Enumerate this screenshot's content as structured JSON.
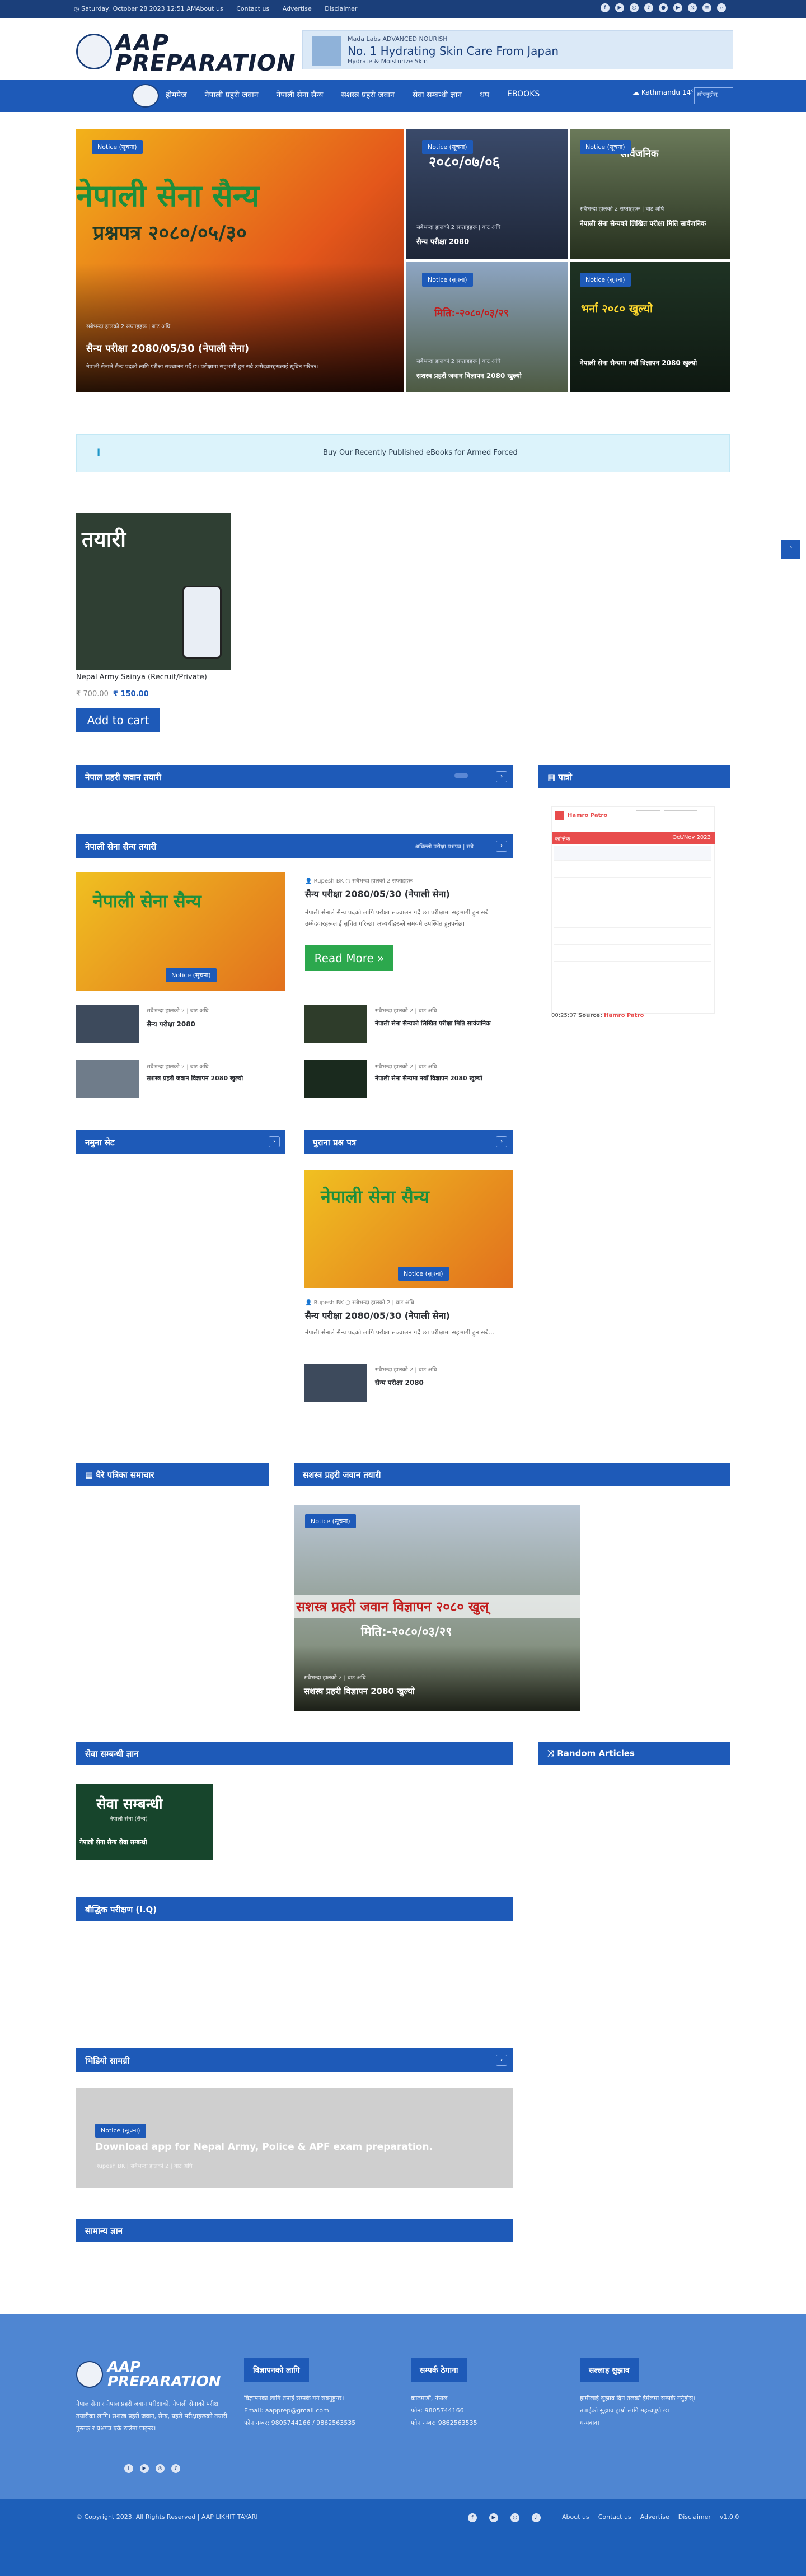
{
  "topbar": {
    "date": "Saturday, October 28 2023 12:51 AM",
    "links": [
      "About us",
      "Contact us",
      "Advertise",
      "Disclaimer"
    ]
  },
  "header": {
    "logo_line1": "AAP",
    "logo_line2": "PREPARATION",
    "ad_small1": "Mada Labs ADVANCED NOURISH",
    "ad_big": "No. 1 Hydrating Skin Care From Japan",
    "ad_small2": "Hydrate & Moisturize Skin"
  },
  "nav": {
    "items": [
      "होमपेज",
      "नेपाली प्रहरी जवान",
      "नेपाली सेना सैन्य",
      "सशस्त्र प्रहरी जवान",
      "सेवा सम्बन्धी ज्ञान",
      "थप",
      "EBOOKS"
    ],
    "weather": "Kathmandu 14",
    "search": "खोज्नुहोस्"
  },
  "hero": {
    "main": {
      "badge": "Notice (सूचना)",
      "title": "सैन्य परीक्षा 2080/05/30 (नेपाली सेना)",
      "meta": "सबैभन्दा हालको 2 सप्ताहहरू | बाट अघि",
      "desc": "नेपाली सेनाले सैन्य पदको लागि परीक्षा सञ्चालन गर्दै छ। परीक्षामा सहभागी हुन सबै उम्मेदवारहरूलाई सूचित गरिन्छ।",
      "banner": "नेपाली सेना सैन्य",
      "banner2": "प्रश्नपत्र २०८०/०५/३०"
    },
    "c1": {
      "badge": "Notice (सूचना)",
      "title": "सैन्य परीक्षा 2080",
      "meta": "सबैभन्दा हालको 2 सप्ताहहरू | बाट अघि",
      "banner": "२०८०/०७/०६"
    },
    "c2": {
      "badge": "Notice (सूचना)",
      "title": "नेपाली सेना सैन्यको लिखित परीक्षा मिति सार्वजनिक",
      "meta": "सबैभन्दा हालको 2 सप्ताहहरू | बाट अघि",
      "banner": "सार्वजनिक"
    },
    "c3": {
      "badge": "Notice (सूचना)",
      "title": "सशस्त्र प्रहरी जवान विज्ञापन 2080 खुल्यो",
      "meta": "सबैभन्दा हालको 2 सप्ताहहरू | बाट अघि",
      "banner": "मिति:-२०८०/०३/२९"
    },
    "c4": {
      "badge": "Notice (सूचना)",
      "title": "नेपाली सेना सैन्यमा नयाँ विज्ञापन 2080 खुल्यो",
      "meta": "सबैभन्दा हालको 2 सप्ताहहरू | बाट अघि",
      "banner": "भर्ना २०८० खुल्यो"
    }
  },
  "notice": {
    "text": "Buy Our Recently Published eBooks for Armed Forced"
  },
  "product": {
    "banner": "तयारी",
    "name": "Nepal Army Sainya (Recruit/Private)",
    "old_price": "₹ 700.00",
    "new_price": "₹ 150.00",
    "cart": "Add to cart"
  },
  "sections": {
    "np": {
      "title": "नेपाल प्रहरी जवान तयारी",
      "extra": ""
    },
    "na": {
      "title": "नेपाली सेना सैन्य तयारी",
      "extra": "अघिल्लो परीक्षा प्रश्नपत्र | सबै"
    },
    "calendar": {
      "title": "पात्रो"
    },
    "sample": {
      "title": "नमुना सेट"
    },
    "old": {
      "title": "पुराना प्रश्न पत्र"
    },
    "dp": {
      "title": "घैरे पत्रिका समाचार"
    },
    "armed": {
      "title": "सशस्त्र प्रहरी जवान तयारी"
    },
    "seva": {
      "title": "सेवा सम्बन्धी ज्ञान"
    },
    "random": {
      "title": "Random Articles"
    },
    "iq": {
      "title": "बौद्धिक परीक्षण (I.Q)"
    },
    "video": {
      "title": "भिडियो सामग्री"
    },
    "general": {
      "title": "सामान्य ज्ञान"
    }
  },
  "calendar": {
    "brand": "Hamro Patro",
    "strip_left": "कात्तिक",
    "strip_right": "Oct/Nov 2023",
    "source": "Source:",
    "source_name": "Hamro Patro",
    "time": "00:25:07"
  },
  "na_featured": {
    "author": "Rupesh BK",
    "date": "सबैभन्दा हालको 2 सप्ताहहरू",
    "title": "सैन्य परीक्षा 2080/05/30 (नेपाली सेना)",
    "desc": "नेपाली सेनाले सैन्य पदको लागि परीक्षा सञ्चालन गर्दै छ। परीक्षामा सहभागी हुन सबै उम्मेदवारहरूलाई सूचित गरिन्छ। अभ्यर्थीहरूले समयमै उपस्थित हुनुपर्नेछ।",
    "badge": "Notice (सूचना)",
    "read_more": "Read More »",
    "banner": "नेपाली सेना सैन्य"
  },
  "na_list": [
    {
      "title": "सैन्य परीक्षा 2080",
      "meta": "सबैभन्दा हालको 2 | बाट अघि"
    },
    {
      "title": "नेपाली सेना सैन्यको लिखित परीक्षा मिति सार्वजनिक",
      "meta": "सबैभन्दा हालको 2 | बाट अघि"
    },
    {
      "title": "सशस्त्र प्रहरी जवान विज्ञापन 2080 खुल्यो",
      "meta": "सबैभन्दा हालको 2 | बाट अघि"
    },
    {
      "title": "नेपाली सेना सैन्यमा नयाँ विज्ञापन 2080 खुल्यो",
      "meta": "सबैभन्दा हालको 2 | बाट अघि"
    }
  ],
  "old_featured": {
    "badge": "Notice (सूचना)",
    "author": "Rupesh BK",
    "date": "सबैभन्दा हालको 2 | बाट अघि",
    "title": "सैन्य परीक्षा 2080/05/30 (नेपाली सेना)",
    "desc": "नेपाली सेनाले सैन्य पदको लागि परीक्षा सञ्चालन गर्दै छ। परीक्षामा सहभागी हुन सबै...",
    "small_title": "सैन्य परीक्षा 2080",
    "small_meta": "सबैभन्दा हालको 2 | बाट अघि"
  },
  "armed_featured": {
    "badge": "Notice (सूचना)",
    "banner": "सशस्त्र प्रहरी जवान विज्ञापन २०८० खुल्",
    "banner2": "मिति:-२०८०/०३/२९",
    "title": "सशस्त्र प्रहरी विज्ञापन 2080 खुल्यो",
    "meta": "सबैभन्दा हालको 2 | बाट अघि"
  },
  "seva_card": {
    "banner": "सेवा सम्बन्धी",
    "sub": "नेपाली सेना (सैन्य)",
    "title": "नेपाली सेना सैन्य सेवा सम्बन्धी"
  },
  "video_card": {
    "badge": "Notice (सूचना)",
    "title": "Download app for Nepal Army, Police & APF exam preparation.",
    "meta": "Rupesh BK | सबैभन्दा हालको 2 | बाट अघि"
  },
  "footer": {
    "about": "नेपाल सेना र नेपाल प्रहरी जवान परीक्षाको, नेपाली सेनाको परीक्षा तयारीका लागि। सशस्त्र प्रहरी जवान, सैन्य, प्रहरी परीक्षाहरूको तयारी पुस्तक र प्रश्नपत्र एकै ठाउँमा पाइन्छ।",
    "col2_title": "विज्ञापनको लागि",
    "col2_lines": [
      "विज्ञापनका लागि तपाईं सम्पर्क गर्न सक्नुहुन्छ।",
      "Email: aapprep@gmail.com",
      "फोन नम्बर: 9805744166 / 9862563535"
    ],
    "col3_title": "सम्पर्क ठेगाना",
    "col3_lines": [
      "काठमाडौं, नेपाल",
      "फोन: 9805744166",
      "फोन नम्बर: 9862563535"
    ],
    "col4_title": "सल्लाह सुझाव",
    "col4_lines": [
      "हामीलाई सुझाव दिन तलको ईमेलमा सम्पर्क गर्नुहोस्।",
      "तपाईंको सुझाव हाम्रो लागि महत्त्वपूर्ण छ।",
      "धन्यवाद।"
    ]
  },
  "bottom": {
    "copyright": "© Copyright 2023, All Rights Reserved | AAP LIKHIT TAYARI",
    "links": [
      "About us",
      "Contact us",
      "Advertise",
      "Disclaimer",
      "v1.0.0"
    ]
  }
}
